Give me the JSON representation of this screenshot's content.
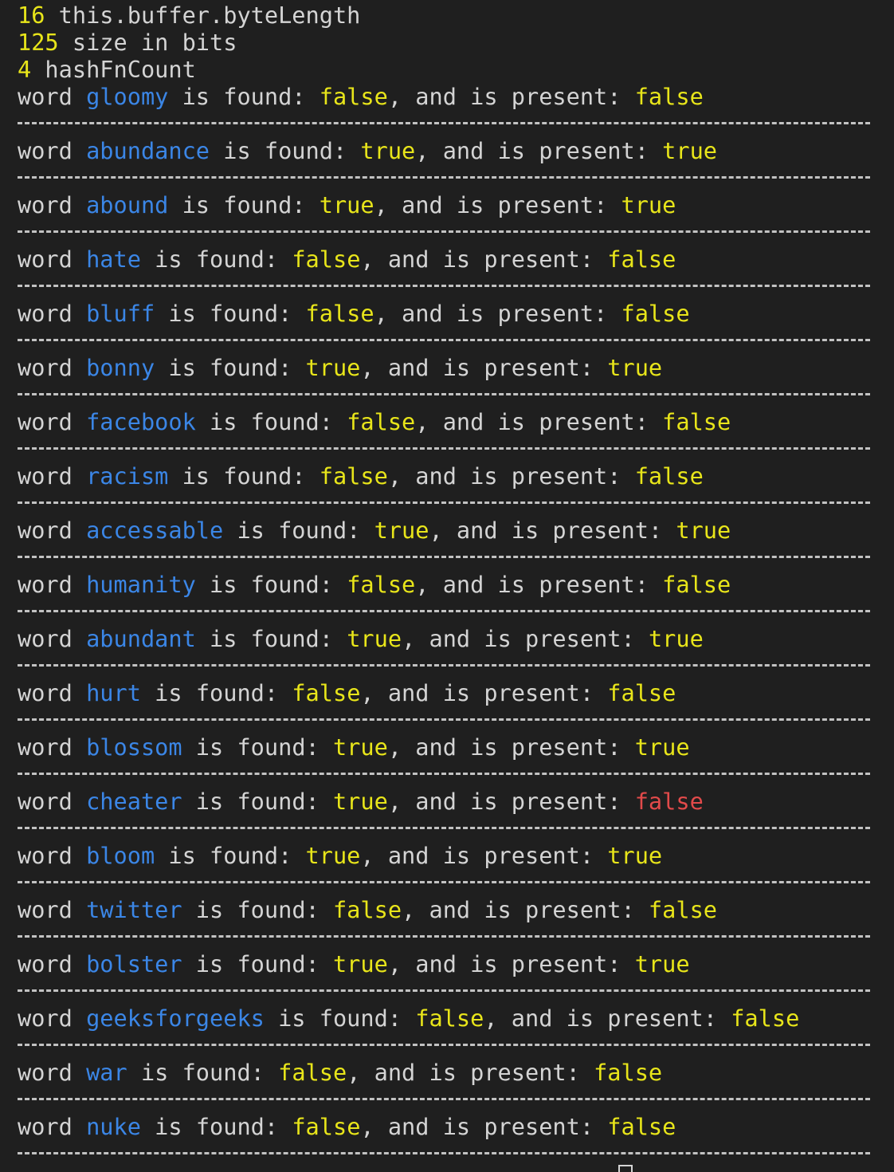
{
  "header_lines": [
    {
      "value": "16",
      "label": " this.buffer.byteLength"
    },
    {
      "value": "125",
      "label": " size in bits"
    },
    {
      "value": "4",
      "label": " hashFnCount"
    }
  ],
  "phrases": {
    "prefix": "word ",
    "found": " is found: ",
    "present": ", and is present: "
  },
  "results": [
    {
      "word": "gloomy",
      "found": "false",
      "present": "false"
    },
    {
      "word": "abundance",
      "found": "true",
      "present": "true"
    },
    {
      "word": "abound",
      "found": "true",
      "present": "true"
    },
    {
      "word": "hate",
      "found": "false",
      "present": "false"
    },
    {
      "word": "bluff",
      "found": "false",
      "present": "false"
    },
    {
      "word": "bonny",
      "found": "true",
      "present": "true"
    },
    {
      "word": "facebook",
      "found": "false",
      "present": "false"
    },
    {
      "word": "racism",
      "found": "false",
      "present": "false"
    },
    {
      "word": "accessable",
      "found": "true",
      "present": "true"
    },
    {
      "word": "humanity",
      "found": "false",
      "present": "false"
    },
    {
      "word": "abundant",
      "found": "true",
      "present": "true"
    },
    {
      "word": "hurt",
      "found": "false",
      "present": "false"
    },
    {
      "word": "blossom",
      "found": "true",
      "present": "true"
    },
    {
      "word": "cheater",
      "found": "true",
      "present": "false",
      "mismatch": true
    },
    {
      "word": "bloom",
      "found": "true",
      "present": "true"
    },
    {
      "word": "twitter",
      "found": "false",
      "present": "false"
    },
    {
      "word": "bolster",
      "found": "true",
      "present": "true"
    },
    {
      "word": "geeksforgeeks",
      "found": "false",
      "present": "false"
    },
    {
      "word": "war",
      "found": "false",
      "present": "false"
    },
    {
      "word": "nuke",
      "found": "false",
      "present": "false"
    }
  ],
  "colors": {
    "background": "#1f1f1f",
    "text": "#d4d4d4",
    "value_yellow": "#e8e51a",
    "word_blue": "#3b86e6",
    "mismatch_red": "#e24a4a"
  },
  "cursor_icon": "block-cursor-icon"
}
